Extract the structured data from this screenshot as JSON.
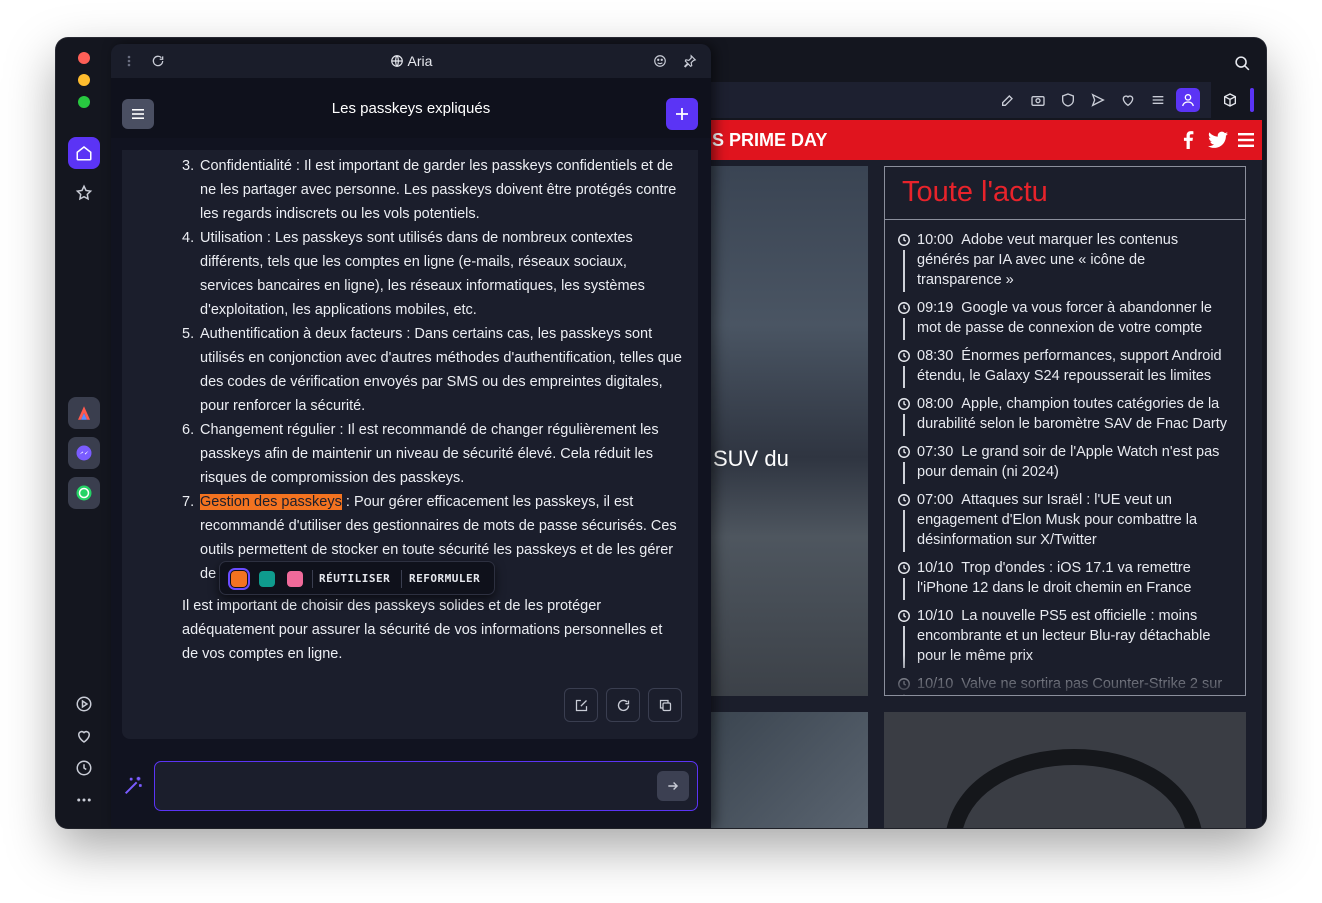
{
  "aria": {
    "app_title": "Aria",
    "conversation_title": "Les passkeys expliqués",
    "list_items": [
      {
        "num": "3.",
        "text": "Confidentialité : Il est important de garder les passkeys confidentiels et de ne les partager avec personne. Les passkeys doivent être protégés contre les regards indiscrets ou les vols potentiels."
      },
      {
        "num": "4.",
        "text": "Utilisation : Les passkeys sont utilisés dans de nombreux contextes différents, tels que les comptes en ligne (e-mails, réseaux sociaux, services bancaires en ligne), les réseaux informatiques, les systèmes d'exploitation, les applications mobiles, etc."
      },
      {
        "num": "5.",
        "text": "Authentification à deux facteurs : Dans certains cas, les passkeys sont utilisés en conjonction avec d'autres méthodes d'authentification, telles que des codes de vérification envoyés par SMS ou des empreintes digitales, pour renforcer la sécurité."
      },
      {
        "num": "6.",
        "text": "Changement régulier : Il est recommandé de changer régulièrement les passkeys afin de maintenir un niveau de sécurité élevé. Cela réduit les risques de compromission des passkeys."
      },
      {
        "num": "7.",
        "highlight": "Gestion des passkeys",
        "text": " : Pour gérer efficacement les passkeys, il est recommandé d'utiliser des gestionnaires de mots de passe sécurisés. Ces outils permettent de stocker en toute sécurité les passkeys et de les gérer de manière pratique."
      }
    ],
    "conclusion": "Il est important de choisir des passkeys solides et de les protéger adéquatement pour assurer la sécurité de vos informations personnelles et de vos comptes en ligne.",
    "popup": {
      "reuse_label": "RÉUTILISER",
      "rephrase_label": "REFORMULER",
      "swatches": [
        "#f37320",
        "#0f9c8e",
        "#f06a9a"
      ]
    },
    "input": {
      "value": "",
      "placeholder": ""
    }
  },
  "page": {
    "banner_text": "S   PRIME DAY",
    "hero_caption": "SUV du",
    "actu_title": "Toute l'actu",
    "news": [
      {
        "time": "10:00",
        "text": "Adobe veut marquer les contenus générés par IA avec une « icône de transparence »"
      },
      {
        "time": "09:19",
        "text": "Google va vous forcer à abandonner le mot de passe de connexion de votre compte"
      },
      {
        "time": "08:30",
        "text": "Énormes performances, support Android étendu, le Galaxy S24 repousserait les limites"
      },
      {
        "time": "08:00",
        "text": "Apple, champion toutes catégories de la durabilité selon le baromètre SAV de Fnac Darty"
      },
      {
        "time": "07:30",
        "text": "Le grand soir de l'Apple Watch n'est pas pour demain (ni 2024)"
      },
      {
        "time": "07:00",
        "text": "Attaques sur Israël : l'UE veut un engagement d'Elon Musk pour combattre la désinformation sur X/Twitter"
      },
      {
        "time": "10/10",
        "text": "Trop d'ondes : iOS 17.1 va remettre l'iPhone 12 dans le droit chemin en France"
      },
      {
        "time": "10/10",
        "text": "La nouvelle PS5 est officielle : moins encombrante et un lecteur Blu-ray détachable pour le même prix"
      },
      {
        "time": "10/10",
        "text": "Valve ne sortira pas Counter-Strike 2 sur"
      }
    ]
  },
  "colors": {
    "accent": "#5b34f5",
    "brand_red": "#e0141e",
    "highlight": "#f37320"
  }
}
